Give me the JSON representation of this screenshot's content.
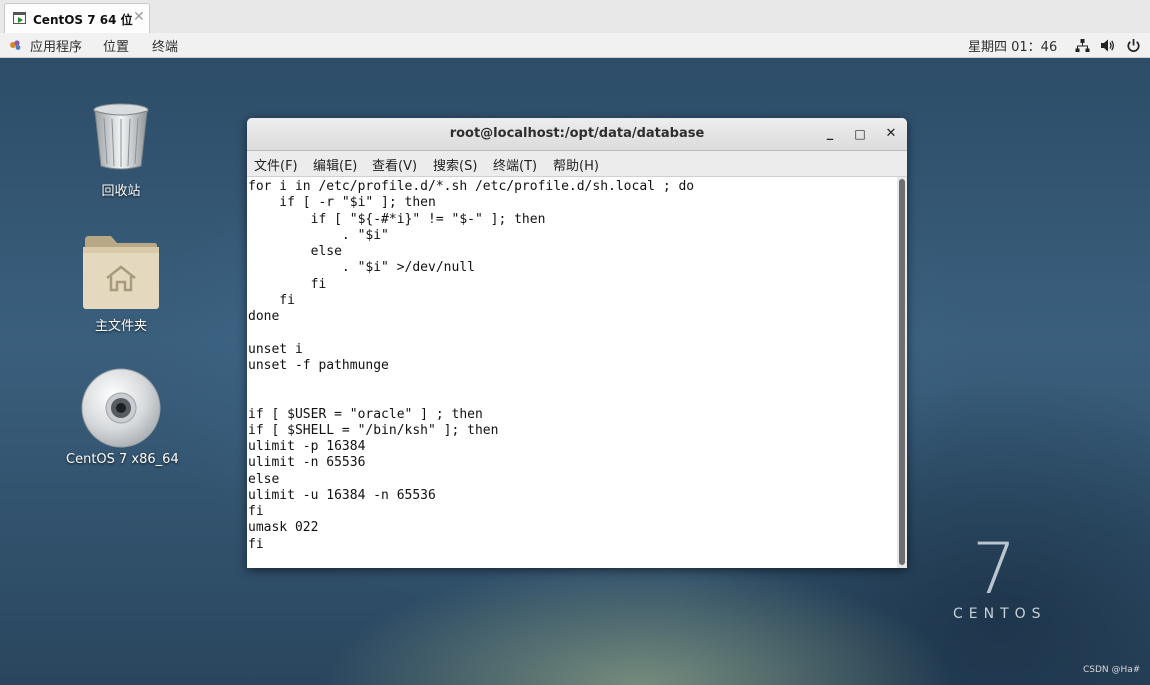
{
  "vm_tab": {
    "label": "CentOS 7 64 位",
    "close": "✕"
  },
  "topbar": {
    "menu": [
      "应用程序",
      "位置",
      "终端"
    ],
    "clock": "星期四 01：46"
  },
  "desktop": {
    "icons": [
      {
        "label": "回收站",
        "icon": "trash-icon"
      },
      {
        "label": "主文件夹",
        "icon": "home-folder-icon"
      },
      {
        "label": "CentOS 7 x86_64",
        "icon": "disc-icon"
      }
    ],
    "branding": {
      "number": "7",
      "word": "CENTOS"
    },
    "watermark": "CSDN @Ha#"
  },
  "terminal": {
    "title": "root@localhost:/opt/data/database",
    "buttons": {
      "minimize": "_",
      "maximize": "□",
      "close": "✕"
    },
    "menu": [
      "文件(F)",
      "编辑(E)",
      "查看(V)",
      "搜索(S)",
      "终端(T)",
      "帮助(H)"
    ],
    "lines": [
      "for i in /etc/profile.d/*.sh /etc/profile.d/sh.local ; do",
      "    if [ -r \"$i\" ]; then",
      "        if [ \"${-#*i}\" != \"$-\" ]; then",
      "            . \"$i\"",
      "        else",
      "            . \"$i\" >/dev/null",
      "        fi",
      "    fi",
      "done",
      "",
      "unset i",
      "unset -f pathmunge",
      "",
      "",
      "if [ $USER = \"oracle\" ] ; then",
      "if [ $SHELL = \"/bin/ksh\" ]; then",
      "ulimit -p 16384",
      "ulimit -n 65536",
      "else",
      "ulimit -u 16384 -n 65536",
      "fi",
      "umask 022",
      "fi"
    ]
  }
}
